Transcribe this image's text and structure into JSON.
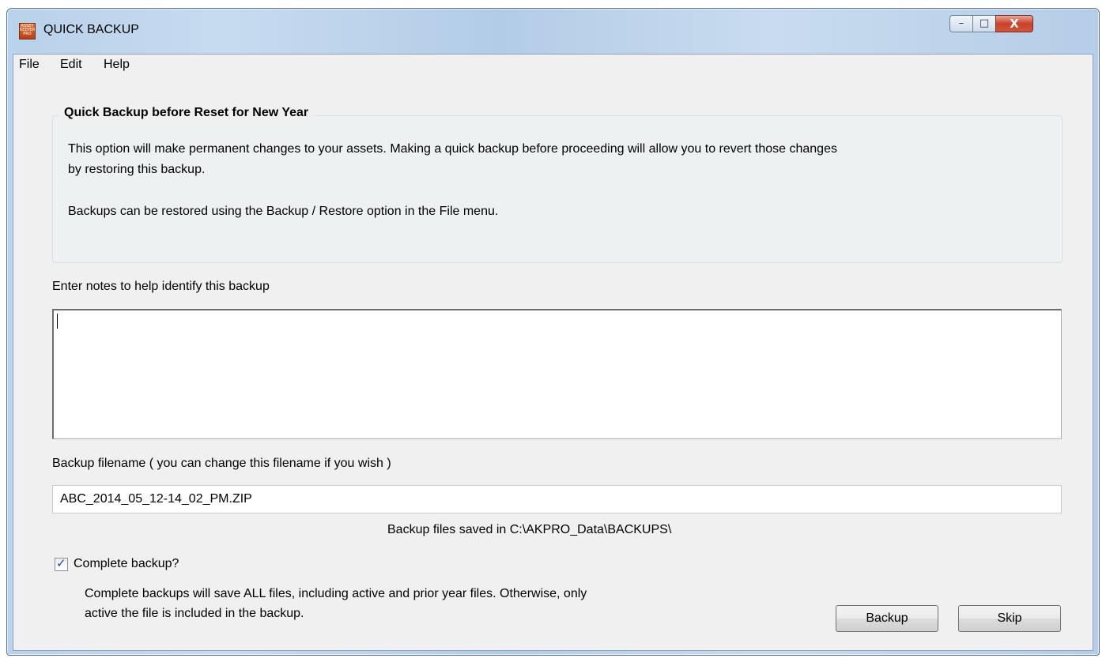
{
  "window": {
    "title": "QUICK BACKUP",
    "app_icon_text": "ASSET KEEPER PRO",
    "controls": {
      "minimize": "–",
      "maximize": "□",
      "close": "X"
    }
  },
  "menu": [
    "File",
    "Edit",
    "Help"
  ],
  "info_group": {
    "title": "Quick Backup before Reset for New Year",
    "line1": "This option will make permanent changes to your assets.  Making a quick backup before proceeding will allow you to revert those changes",
    "line2": "by restoring this backup.",
    "line3": "Backups can be restored using the Backup / Restore option in the File menu."
  },
  "notes": {
    "label": "Enter notes to help identify this backup",
    "value": ""
  },
  "filename": {
    "label": "Backup filename  ( you can change this filename if you wish )",
    "value": "ABC_2014_05_12-14_02_PM.ZIP",
    "saved_in": "Backup files saved in C:\\AKPRO_Data\\BACKUPS\\"
  },
  "complete_backup": {
    "label": "Complete backup?",
    "checked": true,
    "desc_line1": "Complete backups will save ALL files, including active and prior year files.  Otherwise, only",
    "desc_line2": "active the file is included in the backup."
  },
  "buttons": {
    "backup": "Backup",
    "skip": "Skip"
  }
}
